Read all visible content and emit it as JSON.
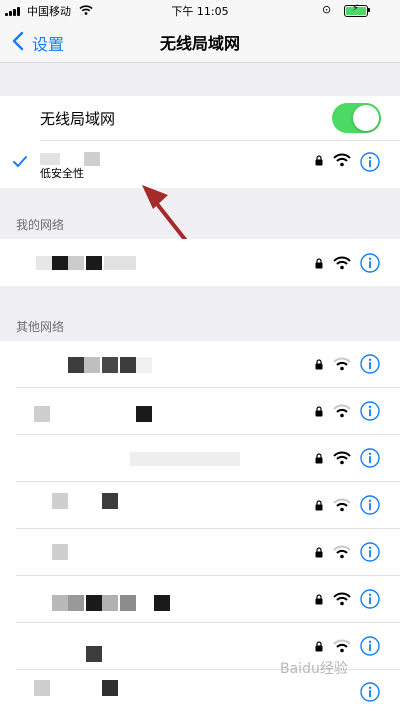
{
  "status_bar": {
    "carrier": "中国移动",
    "time": "下午 11:05"
  },
  "nav": {
    "back_label": "设置",
    "title": "无线局域网"
  },
  "wifi_toggle": {
    "label": "无线局域网",
    "on": true
  },
  "connected": {
    "subtitle": "低安全性"
  },
  "sections": {
    "my_networks": "我的网络",
    "other_networks": "其他网络"
  },
  "colors": {
    "accent": "#147efb",
    "toggle_on": "#4cd964",
    "arrow": "#a52a2a"
  },
  "watermark": "Baidu经验"
}
